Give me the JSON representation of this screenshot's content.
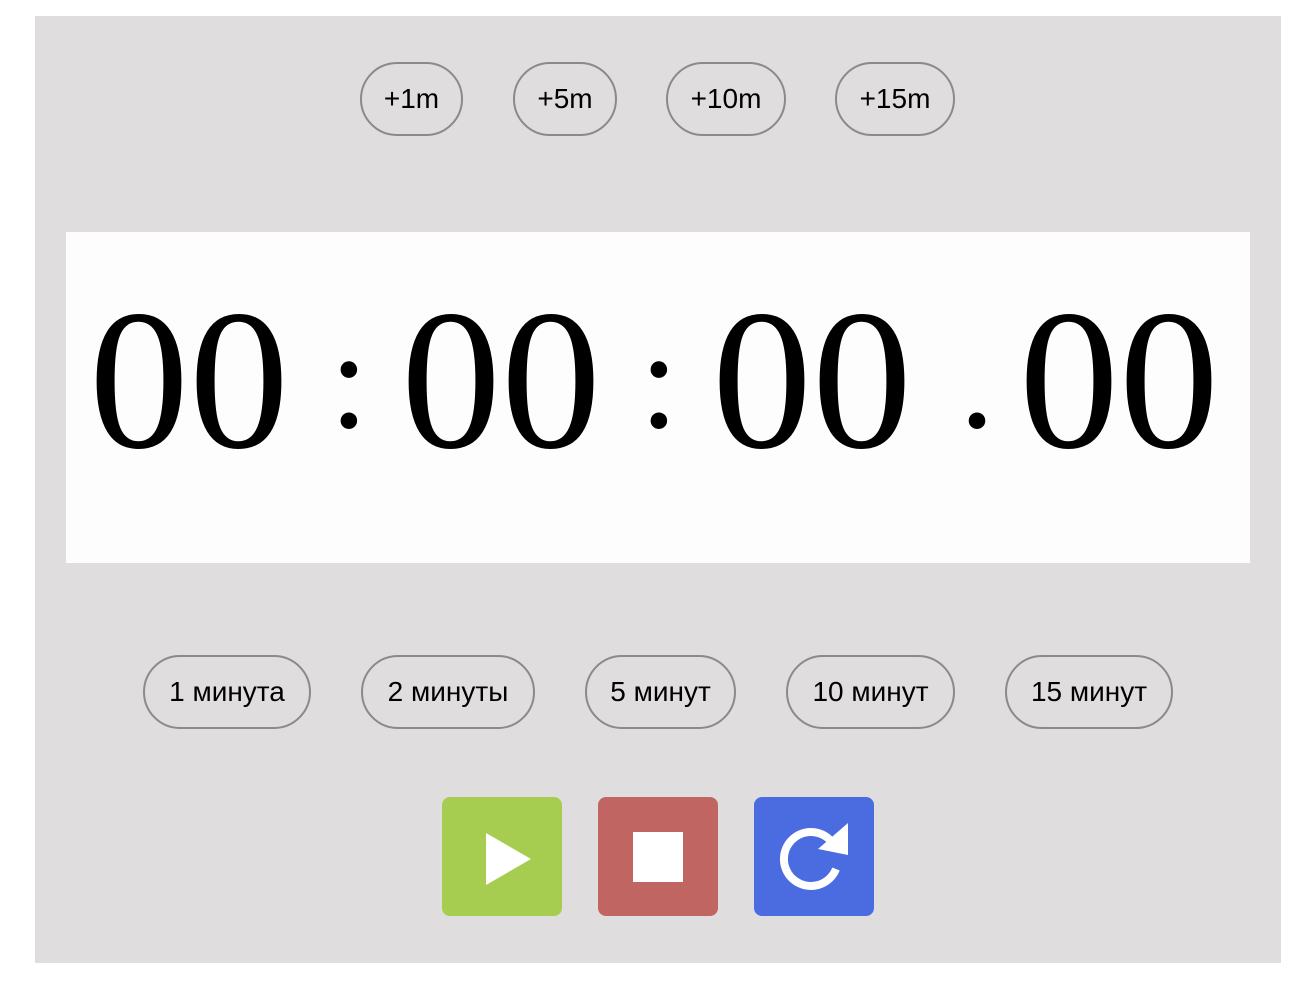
{
  "add_buttons": [
    {
      "label": "+1m"
    },
    {
      "label": "+5m"
    },
    {
      "label": "+10m"
    },
    {
      "label": "+15m"
    }
  ],
  "timer": {
    "hours": "00",
    "minutes": "00",
    "seconds": "00",
    "hundredths": "00",
    "sep_hm": ":",
    "sep_ms": ":",
    "sep_cs": "."
  },
  "presets": [
    {
      "label": "1 минута"
    },
    {
      "label": "2 минуты"
    },
    {
      "label": "5 минут"
    },
    {
      "label": "10 минут"
    },
    {
      "label": "15 минут"
    }
  ],
  "controls": {
    "play": {
      "icon": "play-icon",
      "color": "#a6cd50"
    },
    "stop": {
      "icon": "stop-icon",
      "color": "#c06561"
    },
    "reset": {
      "icon": "refresh-icon",
      "color": "#4a6ce0"
    }
  }
}
